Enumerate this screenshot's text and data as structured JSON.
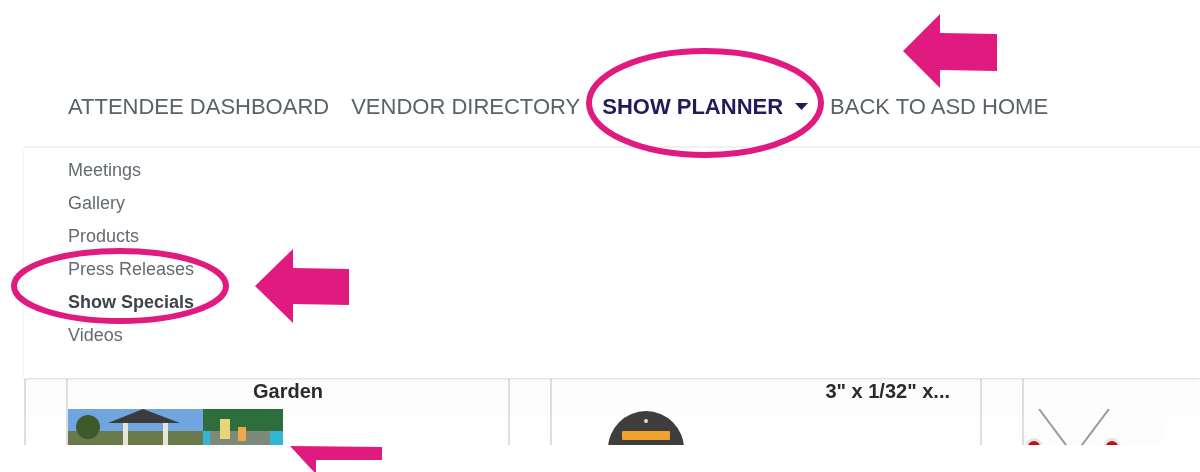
{
  "nav": [
    {
      "label": "ATTENDEE DASHBOARD",
      "selected": false,
      "dropdown": false
    },
    {
      "label": "VENDOR DIRECTORY",
      "selected": false,
      "dropdown": false
    },
    {
      "label": "SHOW PLANNER",
      "selected": true,
      "dropdown": true
    },
    {
      "label": "BACK TO ASD HOME",
      "selected": false,
      "dropdown": false
    }
  ],
  "dropdown_menu": {
    "expanded": true,
    "items": [
      {
        "label": "Meetings",
        "selected": false
      },
      {
        "label": "Gallery",
        "selected": false
      },
      {
        "label": "Products",
        "selected": false
      },
      {
        "label": "Press Releases",
        "selected": false
      },
      {
        "label": "Show Specials",
        "selected": true
      },
      {
        "label": "Videos",
        "selected": false
      }
    ]
  },
  "products": [
    {
      "title": "Garden",
      "image": {
        "kind": "picture"
      }
    },
    {
      "title": "3\" x 1/32\" x...",
      "image": {
        "kind": "picture"
      }
    },
    {
      "image": {
        "kind": "picture"
      }
    }
  ],
  "annotations": [
    {
      "kind": "arrow"
    },
    {
      "kind": "ellipse"
    },
    {
      "kind": "arrow"
    },
    {
      "kind": "ellipse"
    },
    {
      "kind": "arrow"
    }
  ]
}
